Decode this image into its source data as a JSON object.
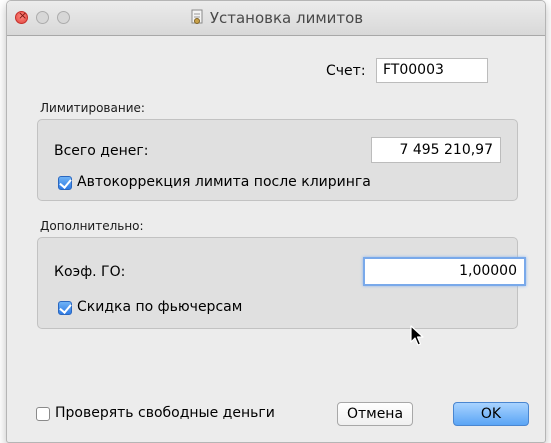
{
  "window": {
    "title": "Установка лимитов"
  },
  "account": {
    "label": "Счет:",
    "value": "FT00003"
  },
  "limits_section": {
    "title": "Лимитирование:",
    "total_money_label": "Всего денег:",
    "total_money_value": "7 495 210,97",
    "autocorrection_label": "Автокоррекция лимита после клиринга",
    "autocorrection_checked": true
  },
  "extra_section": {
    "title": "Дополнительно:",
    "go_coef_label": "Коэф. ГО:",
    "go_coef_value": "1,00000",
    "futures_discount_label": "Скидка по фьючерсам",
    "futures_discount_checked": true
  },
  "footer": {
    "check_free_money_label": "Проверять свободные деньги",
    "check_free_money_checked": false,
    "cancel_label": "Отмена",
    "ok_label": "OK"
  },
  "colors": {
    "accent": "#5aa5f5",
    "close_button": "#e0443e",
    "focus_ring": "#79a9ea"
  }
}
